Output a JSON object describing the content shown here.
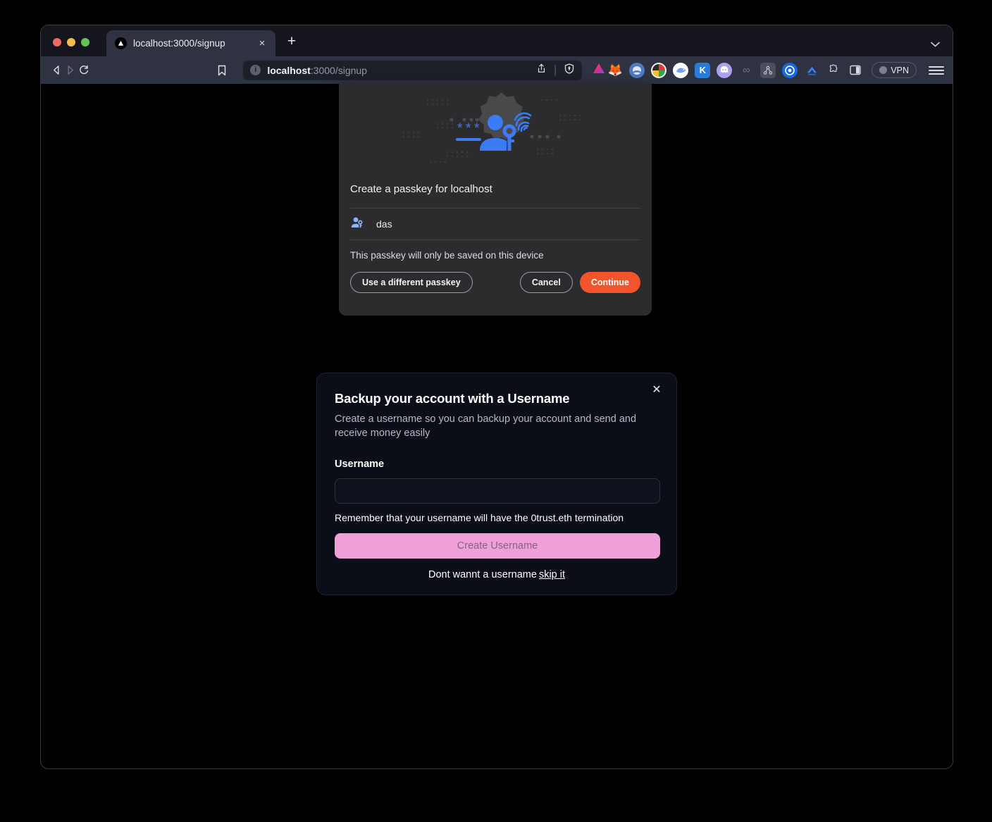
{
  "window": {
    "chevron_icon": "chevron-down-icon",
    "traffic_lights": [
      "close",
      "minimize",
      "zoom"
    ]
  },
  "tab": {
    "title": "localhost:3000/signup",
    "favicon_icon": "brave-triangle-icon",
    "close_label": "×",
    "new_tab_label": "+"
  },
  "toolbar": {
    "back_icon": "back-arrow-icon",
    "forward_icon": "forward-arrow-icon",
    "reload_icon": "reload-icon",
    "bookmark_icon": "bookmark-icon",
    "share_icon": "share-icon",
    "shield_icon": "brave-shield-icon",
    "brave_rewards_icon": "brave-rewards-triangle-icon",
    "menu_icon": "hamburger-menu-icon",
    "vpn_label": "VPN",
    "extensions": [
      {
        "name": "metamask-fox-icon",
        "glyph": "🦊",
        "bg": "transparent"
      },
      {
        "name": "wallet-blue-icon",
        "glyph": "",
        "bg": "#4d79c7"
      },
      {
        "name": "colorful-circle-icon",
        "glyph": "",
        "bg": "#ececec"
      },
      {
        "name": "rabby-wallet-icon",
        "glyph": "",
        "bg": "#ffffff"
      },
      {
        "name": "keplr-wallet-icon",
        "glyph": "K",
        "bg": "#2b7bdd"
      },
      {
        "name": "phantom-wallet-icon",
        "glyph": "",
        "bg": "#ab9ff2"
      },
      {
        "name": "infinity-icon",
        "glyph": "∞",
        "bg": "transparent"
      },
      {
        "name": "graph-node-icon",
        "glyph": "",
        "bg": "transparent"
      },
      {
        "name": "target-blue-icon",
        "glyph": "",
        "bg": "#1668e3"
      },
      {
        "name": "rainbow-wallet-icon",
        "glyph": "",
        "bg": "transparent"
      },
      {
        "name": "puzzle-extension-icon",
        "glyph": "",
        "bg": "transparent"
      },
      {
        "name": "sidebar-panel-icon",
        "glyph": "",
        "bg": "transparent"
      }
    ]
  },
  "url_bar": {
    "site_info_icon": "site-info-icon",
    "host": "localhost",
    "path": ":3000/signup",
    "full": "localhost:3000/signup"
  },
  "passkey_dialog": {
    "hero_icon": "passkey-fingerprint-illustration",
    "title": "Create a passkey for localhost",
    "account_icon": "user-key-icon",
    "account_name": "das",
    "note": "This passkey will only be saved on this device",
    "buttons": {
      "different_passkey": "Use a different passkey",
      "cancel": "Cancel",
      "continue": "Continue"
    },
    "accent_color": "#f4542c"
  },
  "username_modal": {
    "close_icon": "close-icon",
    "title": "Backup your account with a Username",
    "subtitle": "Create a username so you can backup your account and send and receive money easily",
    "field_label": "Username",
    "field_value": "",
    "field_placeholder": "",
    "hint": "Remember that your username will have the 0trust.eth termination",
    "submit_label": "Create Username",
    "skip_prefix": "Dont wannt a username",
    "skip_link": "skip it",
    "accent_color": "#efa0d7"
  }
}
